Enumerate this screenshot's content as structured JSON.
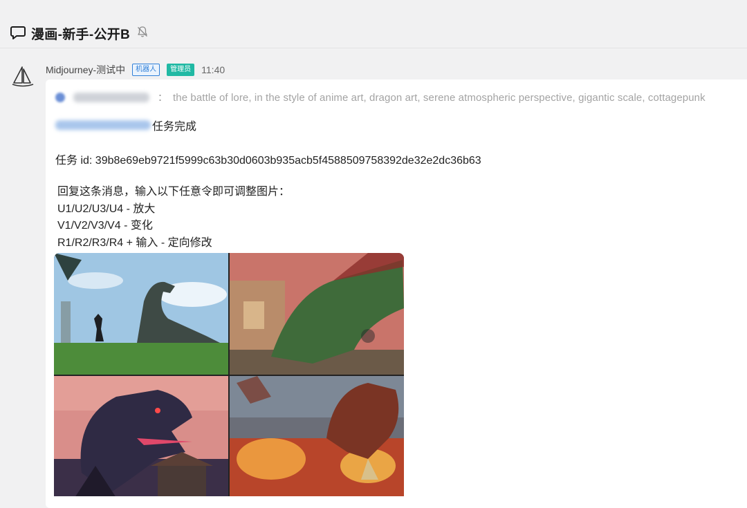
{
  "header": {
    "channel_name": "漫画-新手-公开B",
    "icons": [
      "chat-icon",
      "bell-off-icon"
    ]
  },
  "message": {
    "author": "Midjourney-测试中",
    "badge_bot": "机器人",
    "badge_admin": "管理员",
    "time": "11:40",
    "reply_separator": "：",
    "reply_prompt": "the battle of lore, in the style of anime art, dragon art, serene atmospheric perspective, gigantic scale, cottagepunk",
    "status_text": "任务完成",
    "task_id": "任务 id: 39b8e69eb9721f5999c63b30d0603b935acb5f4588509758392de32e2dc36b63",
    "instructions": [
      "回复这条消息，输入以下任意令即可调整图片：",
      "U1/U2/U3/U4 - 放大",
      "V1/V2/V3/V4 - 变化",
      "R1/R2/R3/R4 + 输入 - 定向修改"
    ]
  },
  "image_grid": {
    "tiles": [
      {
        "label": "dragon-meadow-knight",
        "sky": "#9fc6e3",
        "ground": "#4d8c3a",
        "dragon": "#3e4a45"
      },
      {
        "label": "green-dragon-village",
        "sky": "#c9746a",
        "ground": "#6b5a48",
        "dragon": "#3f6b3a"
      },
      {
        "label": "purple-dragon-roar",
        "sky": "#d98e8a",
        "ground": "#3b2f48",
        "dragon": "#2f2a44"
      },
      {
        "label": "red-dragon-fire",
        "sky": "#6b6e78",
        "ground": "#b8452a",
        "dragon": "#7a3424"
      }
    ]
  },
  "colors": {
    "background": "#f1f1f2",
    "badge_bot": "#2f7fd8",
    "badge_admin": "#21b9a4",
    "prompt_text": "#a3a3a3"
  }
}
